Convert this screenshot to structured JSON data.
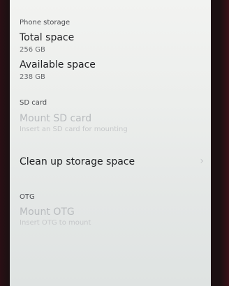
{
  "phone_storage": {
    "section_title": "Phone storage",
    "total": {
      "label": "Total space",
      "value": "256 GB"
    },
    "available": {
      "label": "Available space",
      "value": "238 GB"
    }
  },
  "sd_card": {
    "section_title": "SD card",
    "mount": {
      "label": "Mount SD card",
      "subtitle": "Insert an SD card for mounting",
      "enabled": false
    }
  },
  "cleanup": {
    "label": "Clean up storage space",
    "chevron_icon": "chevron-right-icon"
  },
  "otg": {
    "section_title": "OTG",
    "mount": {
      "label": "Mount OTG",
      "subtitle": "Insert OTG to mount",
      "enabled": false
    }
  },
  "colors": {
    "screen_background": "#eceeec",
    "disabled_text": "#b8bbbe",
    "primary_text": "#1f2023"
  }
}
